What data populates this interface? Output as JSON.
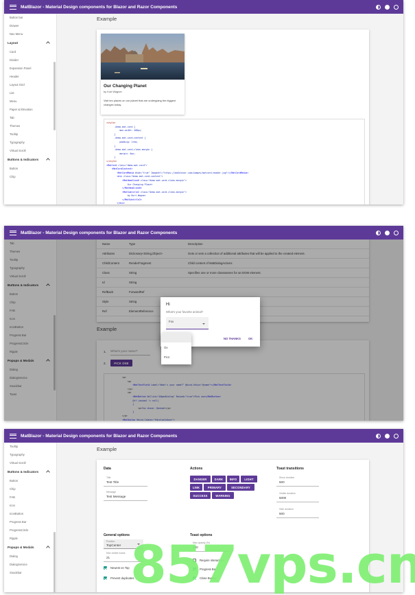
{
  "app": {
    "title": "MatBlazor - Material Design components for Blazor and Razor Components",
    "primary_color": "#5e3a98"
  },
  "shot1": {
    "sidebar": {
      "items_top": [
        "Button bar",
        "Drawer",
        "Nav Menu"
      ],
      "layout_group": "Layout",
      "layout_items": [
        "Card",
        "Divider",
        "Expansion Panel",
        "Header",
        "Layout Grid",
        "List",
        "Menu",
        "Paper & Elevation",
        "Tab",
        "Themes",
        "Tooltip",
        "Typography",
        "Virtual Scroll"
      ],
      "buttons_group": "Buttons & Indicators",
      "buttons_items": [
        "Button",
        "Chip"
      ]
    },
    "heading": "Example",
    "card": {
      "title": "Our Changing Planet",
      "subtitle": "by Kurt Wagner",
      "body": "Visit ten places on our planet that are undergoing the biggest changes today."
    }
  },
  "shot2": {
    "sidebar": {
      "items_top": [
        "Tab",
        "Themes",
        "Tooltip",
        "Typography",
        "Virtual Scroll"
      ],
      "buttons_group": "Buttons & Indicators",
      "buttons_items": [
        "Button",
        "Chip",
        "FAB",
        "Icon",
        "IconButton",
        "Progress Bar",
        "ProgressCircle",
        "Ripple"
      ],
      "popups_group": "Popups & Modals",
      "popups_items": [
        "Dialog",
        "DialogService",
        "Snackbar",
        "Toast"
      ]
    },
    "table": [
      {
        "name": "Name",
        "type": "Type",
        "desc": "Description"
      },
      {
        "name": "Attributes",
        "type": "Dictionary<String,Object>",
        "desc": "Gets or sets a collection of additional attributes that will be applied to the created element."
      },
      {
        "name": "ChildContent",
        "type": "RenderFragment",
        "desc": "Child content of MatDialogActions"
      },
      {
        "name": "Class",
        "type": "String",
        "desc": "Specifies one or more classnames for an DOM element."
      },
      {
        "name": "Id",
        "type": "String",
        "desc": ""
      },
      {
        "name": "RefBack",
        "type": "ForwardRef",
        "desc": ""
      },
      {
        "name": "Style",
        "type": "String",
        "desc": "Specifies an inline style for an DOM element."
      },
      {
        "name": "Ref",
        "type": "ElementReference",
        "desc": ""
      }
    ],
    "heading": "Example",
    "stepper": {
      "step1_num": "1.",
      "step1_placeholder": "What's your name?",
      "step2_num": "2.",
      "pick_button": "PICK ONE"
    },
    "dialog": {
      "title": "Hi",
      "question": "What's your favorite animal?",
      "select_value": "Fox",
      "no_thanks": "NO THANKS",
      "ok": "OK",
      "options": [
        "",
        "Ox",
        "Prot"
      ]
    }
  },
  "shot3": {
    "sidebar": {
      "items_top": [
        "Tooltip",
        "Typography",
        "Virtual Scroll"
      ],
      "buttons_group": "Buttons & Indicators",
      "buttons_items": [
        "Button",
        "Chip",
        "FAB",
        "Icon",
        "IconButton",
        "Progress Bar",
        "ProgressCircle",
        "Ripple"
      ],
      "popups_group": "Popups & Modals",
      "popups_items": [
        "Dialog",
        "DialogService",
        "Snackbar"
      ]
    },
    "heading": "Example",
    "data": {
      "title": "Data",
      "title_label": "Title",
      "title_value": "Test Title",
      "message_label": "Message",
      "message_value": "Test Message"
    },
    "actions": {
      "title": "Actions",
      "buttons": [
        "DANGER",
        "DARK",
        "INFO",
        "LIGHT",
        "LINK",
        "PRIMARY",
        "SECONDARY",
        "SUCCESS",
        "WARNING"
      ]
    },
    "transitions": {
      "title": "Toast transitions",
      "fields": [
        {
          "label": "Show duration",
          "value": "500"
        },
        {
          "label": "Visible duration",
          "value": "5000"
        },
        {
          "label": "Hide duration",
          "value": "500"
        }
      ]
    },
    "general": {
      "title": "General options",
      "position_label": "Position",
      "position_value": "TopCenter",
      "max_label": "Max visible toasts",
      "max_value": "21",
      "newest_label": "Newest on Top",
      "prevent_label": "Prevent duplicates"
    },
    "toast_options": {
      "title": "Toast options",
      "max_opacity_label": "Max opacity (%)",
      "max_opacity_value": "100",
      "require_label": "Require interaction",
      "progress_label": "Progress Bar",
      "close_label": "Close Button"
    }
  },
  "watermark": "857vps.cn"
}
